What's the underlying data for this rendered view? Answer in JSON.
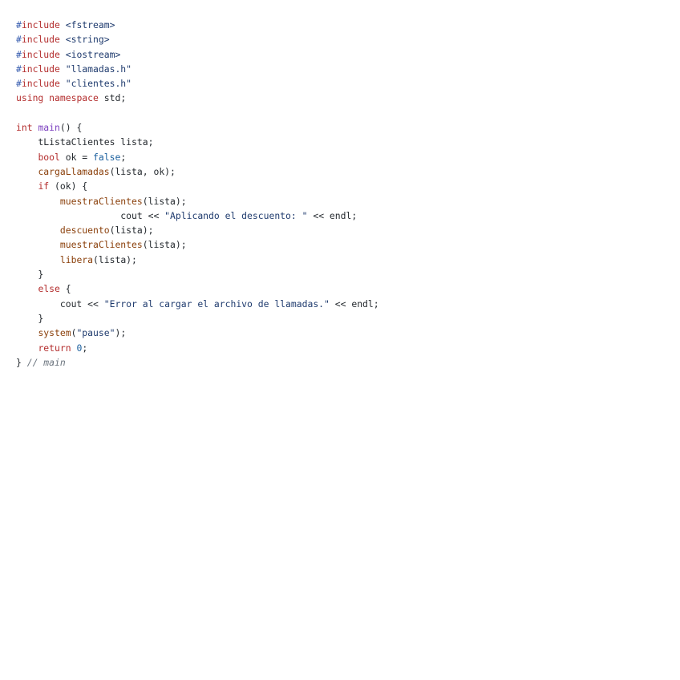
{
  "code": {
    "lines": [
      [
        {
          "t": "#",
          "c": "hash"
        },
        {
          "t": "include",
          "c": "pp"
        },
        {
          "t": " ",
          "c": "plain"
        },
        {
          "t": "<fstream>",
          "c": "str"
        }
      ],
      [
        {
          "t": "#",
          "c": "hash"
        },
        {
          "t": "include",
          "c": "pp"
        },
        {
          "t": " ",
          "c": "plain"
        },
        {
          "t": "<string>",
          "c": "str"
        }
      ],
      [
        {
          "t": "#",
          "c": "hash"
        },
        {
          "t": "include",
          "c": "pp"
        },
        {
          "t": " ",
          "c": "plain"
        },
        {
          "t": "<iostream>",
          "c": "str"
        }
      ],
      [
        {
          "t": "#",
          "c": "hash"
        },
        {
          "t": "include",
          "c": "pp"
        },
        {
          "t": " ",
          "c": "plain"
        },
        {
          "t": "\"llamadas.h\"",
          "c": "str"
        }
      ],
      [
        {
          "t": "#",
          "c": "hash"
        },
        {
          "t": "include",
          "c": "pp"
        },
        {
          "t": " ",
          "c": "plain"
        },
        {
          "t": "\"clientes.h\"",
          "c": "str"
        }
      ],
      [
        {
          "t": "using",
          "c": "kw"
        },
        {
          "t": " ",
          "c": "plain"
        },
        {
          "t": "namespace",
          "c": "kw"
        },
        {
          "t": " std;",
          "c": "plain"
        }
      ],
      [],
      [
        {
          "t": "int",
          "c": "kw"
        },
        {
          "t": " ",
          "c": "plain"
        },
        {
          "t": "main",
          "c": "main"
        },
        {
          "t": "() {",
          "c": "plain"
        }
      ],
      [
        {
          "t": "    tListaClientes lista;",
          "c": "plain"
        }
      ],
      [
        {
          "t": "    ",
          "c": "plain"
        },
        {
          "t": "bool",
          "c": "kw"
        },
        {
          "t": " ok = ",
          "c": "plain"
        },
        {
          "t": "false",
          "c": "const"
        },
        {
          "t": ";",
          "c": "plain"
        }
      ],
      [
        {
          "t": "    ",
          "c": "plain"
        },
        {
          "t": "cargaLlamadas",
          "c": "fn"
        },
        {
          "t": "(lista, ok);",
          "c": "plain"
        }
      ],
      [
        {
          "t": "    ",
          "c": "plain"
        },
        {
          "t": "if",
          "c": "kw"
        },
        {
          "t": " (ok) {",
          "c": "plain"
        }
      ],
      [
        {
          "t": "        ",
          "c": "plain"
        },
        {
          "t": "muestraClientes",
          "c": "fn"
        },
        {
          "t": "(lista);",
          "c": "plain"
        }
      ],
      [
        {
          "t": "                   cout << ",
          "c": "plain"
        },
        {
          "t": "\"Aplicando el descuento: \"",
          "c": "str"
        },
        {
          "t": " << endl;",
          "c": "plain"
        }
      ],
      [
        {
          "t": "        ",
          "c": "plain"
        },
        {
          "t": "descuento",
          "c": "fn"
        },
        {
          "t": "(lista);",
          "c": "plain"
        }
      ],
      [
        {
          "t": "        ",
          "c": "plain"
        },
        {
          "t": "muestraClientes",
          "c": "fn"
        },
        {
          "t": "(lista);",
          "c": "plain"
        }
      ],
      [
        {
          "t": "        ",
          "c": "plain"
        },
        {
          "t": "libera",
          "c": "fn"
        },
        {
          "t": "(lista);",
          "c": "plain"
        }
      ],
      [
        {
          "t": "    }",
          "c": "plain"
        }
      ],
      [
        {
          "t": "    ",
          "c": "plain"
        },
        {
          "t": "else",
          "c": "kw"
        },
        {
          "t": " {",
          "c": "plain"
        }
      ],
      [
        {
          "t": "        cout << ",
          "c": "plain"
        },
        {
          "t": "\"Error al cargar el archivo de llamadas.\"",
          "c": "str"
        },
        {
          "t": " << endl;",
          "c": "plain"
        }
      ],
      [
        {
          "t": "    }",
          "c": "plain"
        }
      ],
      [
        {
          "t": "    ",
          "c": "plain"
        },
        {
          "t": "system",
          "c": "fn"
        },
        {
          "t": "(",
          "c": "plain"
        },
        {
          "t": "\"pause\"",
          "c": "str"
        },
        {
          "t": ");",
          "c": "plain"
        }
      ],
      [
        {
          "t": "    ",
          "c": "plain"
        },
        {
          "t": "return",
          "c": "kw"
        },
        {
          "t": " ",
          "c": "plain"
        },
        {
          "t": "0",
          "c": "num"
        },
        {
          "t": ";",
          "c": "plain"
        }
      ],
      [
        {
          "t": "} ",
          "c": "plain"
        },
        {
          "t": "// main",
          "c": "cmt"
        }
      ]
    ]
  }
}
